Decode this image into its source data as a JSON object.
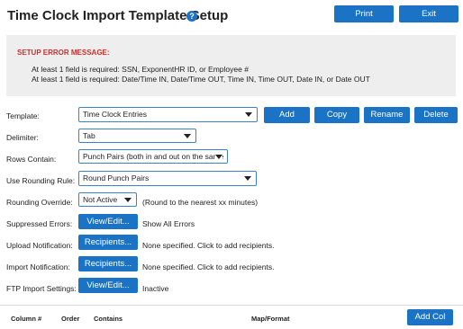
{
  "header": {
    "title": "Time Clock Import Template Setup",
    "help_glyph": "?",
    "print_label": "Print",
    "exit_label": "Exit"
  },
  "error": {
    "heading": "SETUP ERROR MESSAGE:",
    "lines": [
      "At least 1 field is required: SSN, ExponentHR ID, or Employee #",
      "At least 1 field is required: Date/Time IN, Date/Time OUT, Time IN, Time OUT, Date IN, or Date OUT"
    ]
  },
  "form": {
    "template": {
      "label": "Template:",
      "value": "Time Clock Entries"
    },
    "template_actions": {
      "add": "Add",
      "copy": "Copy",
      "rename": "Rename",
      "delete": "Delete"
    },
    "delimiter": {
      "label": "Delimiter:",
      "value": "Tab"
    },
    "rows_contain": {
      "label": "Rows Contain:",
      "value": "Punch Pairs (both in and out on the same"
    },
    "rounding_rule": {
      "label": "Use Rounding Rule:",
      "value": "Round Punch Pairs"
    },
    "rounding_override": {
      "label": "Rounding Override:",
      "value": "Not Active",
      "note": "(Round to the nearest xx minutes)"
    },
    "suppressed_errors": {
      "label": "Suppressed Errors:",
      "button": "View/Edit...",
      "note": "Show All Errors"
    },
    "upload_notification": {
      "label": "Upload Notification:",
      "button": "Recipients...",
      "note": "None specified. Click to add recipients."
    },
    "import_notification": {
      "label": "Import Notification:",
      "button": "Recipients...",
      "note": "None specified. Click to add recipients."
    },
    "ftp_import": {
      "label": "FTP Import Settings:",
      "button": "View/Edit...",
      "note": "Inactive"
    }
  },
  "table": {
    "columns": [
      "Column #",
      "Order",
      "Contains",
      "Map/Format"
    ],
    "add_col_label": "Add Col"
  },
  "colors": {
    "accent": "#1a73c4",
    "error": "#d42b2b",
    "panel": "#eeeeee"
  }
}
